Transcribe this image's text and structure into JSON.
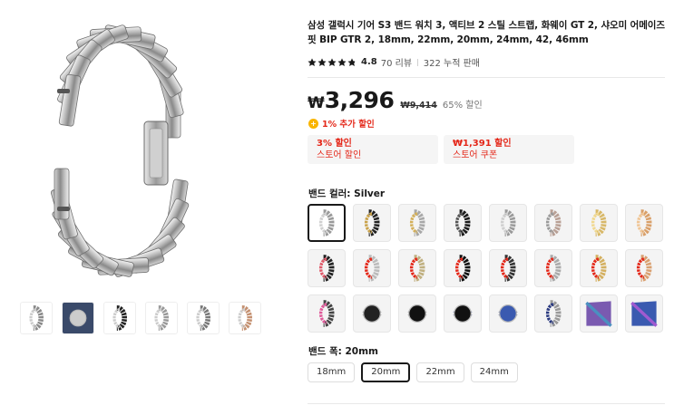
{
  "product": {
    "title": "삼성 갤럭시 기어 S3 밴드 워치 3, 액티브 2 스틸 스트랩, 화웨이 GT 2, 샤오미 어메이즈핏 BIP GTR 2, 18mm, 22mm, 20mm, 24mm, 42, 46mm",
    "rating": "4.8",
    "reviews": "70 리뷰",
    "sold": "322 누적 판매"
  },
  "price": {
    "currency": "₩",
    "current": "3,296",
    "original": "₩9,414",
    "discount": "65% 할인",
    "extra": "1% 추가 할인"
  },
  "coupons": [
    {
      "value": "3% 할인",
      "label": "스토어 할인"
    },
    {
      "value": "₩1,391 할인",
      "label": "스토어 쿠폰"
    }
  ],
  "color": {
    "label": "밴드 컬러: ",
    "selected": "Silver"
  },
  "size": {
    "label": "밴드 폭: ",
    "selected": "20mm",
    "options": [
      "18mm",
      "20mm",
      "22mm",
      "24mm"
    ]
  },
  "swatches": [
    {
      "band": "#9a9a9a",
      "accent": "#d0d0d0",
      "kind": "link"
    },
    {
      "band": "#222222",
      "accent": "#c9a24a",
      "kind": "link"
    },
    {
      "band": "#a8a8a8",
      "accent": "#d4b05a",
      "kind": "link"
    },
    {
      "band": "#1c1c1c",
      "accent": "#555555",
      "kind": "link"
    },
    {
      "band": "#9a9a9a",
      "accent": "#cfcfcf",
      "kind": "link"
    },
    {
      "band": "#b9a095",
      "accent": "#9a9a9a",
      "kind": "link"
    },
    {
      "band": "#d8b868",
      "accent": "#f0d890",
      "kind": "link"
    },
    {
      "band": "#d9a06a",
      "accent": "#f0c595",
      "kind": "link"
    },
    {
      "band": "#222222",
      "accent": "#e05a6a",
      "kind": "link"
    },
    {
      "band": "#bbbbbb",
      "accent": "#e4281a",
      "kind": "link"
    },
    {
      "band": "#c0b080",
      "accent": "#e4281a",
      "kind": "link"
    },
    {
      "band": "#111111",
      "accent": "#e4281a",
      "kind": "link"
    },
    {
      "band": "#333333",
      "accent": "#e4281a",
      "kind": "link"
    },
    {
      "band": "#aaaaaa",
      "accent": "#e4281a",
      "kind": "link"
    },
    {
      "band": "#d4b060",
      "accent": "#e4281a",
      "kind": "link"
    },
    {
      "band": "#d9a070",
      "accent": "#e4281a",
      "kind": "link"
    },
    {
      "band": "#444444",
      "accent": "#e05a9a",
      "kind": "link"
    },
    {
      "band": "#666666",
      "accent": "#222222",
      "kind": "watch"
    },
    {
      "band": "#777777",
      "accent": "#111111",
      "kind": "watch"
    },
    {
      "band": "#223a88",
      "accent": "#111111",
      "kind": "watch"
    },
    {
      "band": "#1b2f7a",
      "accent": "#3a5ab0",
      "kind": "watch"
    },
    {
      "band": "#999999",
      "accent": "#2a3a80",
      "kind": "link"
    },
    {
      "band": "#7a5ab0",
      "accent": "#4a90c0",
      "kind": "mesh"
    },
    {
      "band": "#3a5ab0",
      "accent": "#a05ad0",
      "kind": "mesh"
    }
  ],
  "thumbnails": [
    {
      "name": "thumb-silver-band",
      "band": "#8a8a8a",
      "bg": "#ffffff"
    },
    {
      "name": "thumb-wrist-photo",
      "band": "#2a3050",
      "bg": "#3a4a6a"
    },
    {
      "name": "thumb-black-band",
      "band": "#222222",
      "bg": "#ffffff"
    },
    {
      "name": "thumb-color-options",
      "band": "#999999",
      "bg": "#ffffff"
    },
    {
      "name": "thumb-size-chart",
      "band": "#777777",
      "bg": "#ffffff"
    },
    {
      "name": "thumb-rosegold-band",
      "band": "#c49070",
      "bg": "#ffffff"
    }
  ],
  "colors": {
    "accent_red": "#e4281a",
    "selected_border": "#191919",
    "coin": "#f9b500"
  }
}
